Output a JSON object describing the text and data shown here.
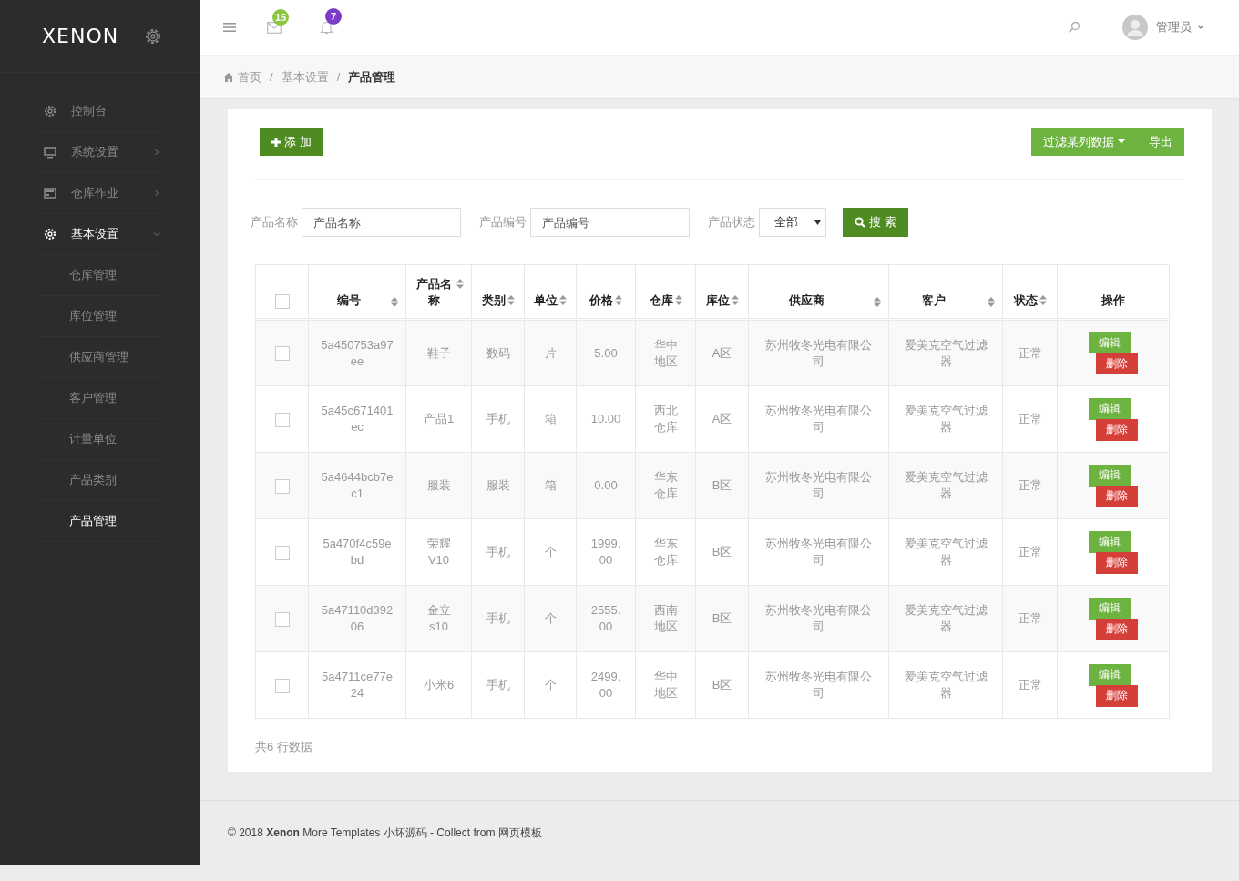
{
  "sidebar": {
    "logo": "XENON",
    "items": [
      {
        "label": "控制台",
        "expanded": false,
        "has_children": false
      },
      {
        "label": "系统设置",
        "expanded": false,
        "has_children": true
      },
      {
        "label": "仓库作业",
        "expanded": false,
        "has_children": true
      },
      {
        "label": "基本设置",
        "expanded": true,
        "has_children": true,
        "children": [
          {
            "label": "仓库管理",
            "selected": false
          },
          {
            "label": "库位管理",
            "selected": false
          },
          {
            "label": "供应商管理",
            "selected": false
          },
          {
            "label": "客户管理",
            "selected": false
          },
          {
            "label": "计量单位",
            "selected": false
          },
          {
            "label": "产品类别",
            "selected": false
          },
          {
            "label": "产品管理",
            "selected": true
          }
        ]
      }
    ]
  },
  "header": {
    "mail_badge": "15",
    "bell_badge": "7",
    "user": "管理员"
  },
  "breadcrumb": {
    "separator": "/",
    "items": [
      "首页",
      "基本设置",
      "产品管理"
    ]
  },
  "toolbar": {
    "add": "添 加",
    "filter": "过滤某列数据",
    "export": "导出"
  },
  "filters": [
    {
      "label": "产品名称",
      "kind": "text",
      "placeholder": "产品名称"
    },
    {
      "label": "产品编号",
      "kind": "text",
      "placeholder": "产品编号"
    },
    {
      "label": "产品状态",
      "kind": "select",
      "value": "全部"
    }
  ],
  "search_button": "搜 索",
  "table": {
    "select_all": {
      "checked": false
    },
    "columns": [
      {
        "label": "编号",
        "sortable": true
      },
      {
        "label": "产品名称",
        "sortable": true
      },
      {
        "label": "类别",
        "sortable": true
      },
      {
        "label": "单位",
        "sortable": true
      },
      {
        "label": "价格",
        "sortable": true
      },
      {
        "label": "仓库",
        "sortable": true
      },
      {
        "label": "库位",
        "sortable": true
      },
      {
        "label": "供应商",
        "sortable": true
      },
      {
        "label": "客户",
        "sortable": true
      },
      {
        "label": "状态",
        "sortable": true
      },
      {
        "label": "操作",
        "sortable": false
      }
    ],
    "rows": [
      {
        "checked": false,
        "cells": [
          "5a450753a97ee",
          "鞋子",
          "数码",
          "片",
          "5.00",
          "华中地区",
          "A区",
          "苏州牧冬光电有限公司",
          "爱美克空气过滤器",
          "正常"
        ],
        "actions": [
          {
            "kind": "edit",
            "label": "编辑"
          },
          {
            "kind": "delete",
            "label": "删除"
          }
        ]
      },
      {
        "checked": false,
        "cells": [
          "5a45c671401ec",
          "产品1",
          "手机",
          "箱",
          "10.00",
          "西北仓库",
          "A区",
          "苏州牧冬光电有限公司",
          "爱美克空气过滤器",
          "正常"
        ],
        "actions": [
          {
            "kind": "edit",
            "label": "编辑"
          },
          {
            "kind": "delete",
            "label": "删除"
          }
        ]
      },
      {
        "checked": false,
        "cells": [
          "5a4644bcb7ec1",
          "服装",
          "服装",
          "箱",
          "0.00",
          "华东仓库",
          "B区",
          "苏州牧冬光电有限公司",
          "爱美克空气过滤器",
          "正常"
        ],
        "actions": [
          {
            "kind": "edit",
            "label": "编辑"
          },
          {
            "kind": "delete",
            "label": "删除"
          }
        ]
      },
      {
        "checked": false,
        "cells": [
          "5a470f4c59ebd",
          "荣耀V10",
          "手机",
          "个",
          "1999.00",
          "华东仓库",
          "B区",
          "苏州牧冬光电有限公司",
          "爱美克空气过滤器",
          "正常"
        ],
        "actions": [
          {
            "kind": "edit",
            "label": "编辑"
          },
          {
            "kind": "delete",
            "label": "删除"
          }
        ]
      },
      {
        "checked": false,
        "cells": [
          "5a47110d39206",
          "金立s10",
          "手机",
          "个",
          "2555.00",
          "西南地区",
          "B区",
          "苏州牧冬光电有限公司",
          "爱美克空气过滤器",
          "正常"
        ],
        "actions": [
          {
            "kind": "edit",
            "label": "编辑"
          },
          {
            "kind": "delete",
            "label": "删除"
          }
        ]
      },
      {
        "checked": false,
        "cells": [
          "5a4711ce77e24",
          "小米6",
          "手机",
          "个",
          "2499.00",
          "华中地区",
          "B区",
          "苏州牧冬光电有限公司",
          "爱美克空气过滤器",
          "正常"
        ],
        "actions": [
          {
            "kind": "edit",
            "label": "编辑"
          },
          {
            "kind": "delete",
            "label": "删除"
          }
        ]
      }
    ],
    "count": "共6 行数据"
  },
  "footer": "© 2018 **Xenon** More Templates 小坏源码 - Collect from 网页模板"
}
